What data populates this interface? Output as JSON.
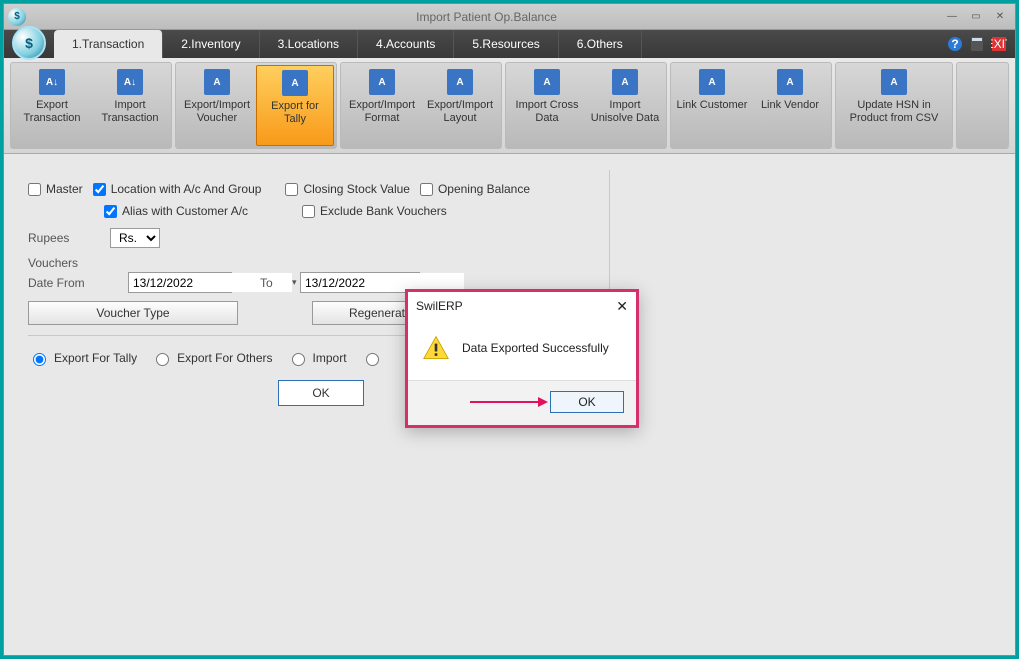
{
  "window": {
    "title": "Import Patient Op.Balance",
    "logo_letter": "$"
  },
  "tabs": {
    "t1": "1.Transaction",
    "t2": "2.Inventory",
    "t3": "3.Locations",
    "t4": "4.Accounts",
    "t5": "5.Resources",
    "t6": "6.Others"
  },
  "ribbon": {
    "g1": {
      "a": "Export Transaction",
      "b": "Import Transaction"
    },
    "g2": {
      "a": "Export/Import Voucher",
      "b": "Export for Tally"
    },
    "g3": {
      "a": "Export/Import Format",
      "b": "Export/Import Layout"
    },
    "g4": {
      "a": "Import Cross Data",
      "b": "Import Unisolve Data"
    },
    "g5": {
      "a": "Link Customer",
      "b": "Link Vendor"
    },
    "g6": {
      "a": "Update HSN in Product from CSV"
    }
  },
  "form": {
    "master": "Master",
    "loc_group": "Location with A/c And Group",
    "closing": "Closing Stock Value",
    "opening": "Opening Balance",
    "alias": "Alias with Customer A/c",
    "exclude_bank": "Exclude Bank Vouchers",
    "rupees_label": "Rupees",
    "rupees_value": "Rs.",
    "vouchers_label": "Vouchers",
    "date_from_label": "Date From",
    "date_from": "13/12/2022",
    "to_label": "To",
    "date_to": "13/12/2022",
    "voucher_type_btn": "Voucher Type",
    "regen_btn": "Regenerate Closing",
    "r_tally": "Export For Tally",
    "r_others": "Export For Others",
    "r_import": "Import",
    "ok": "OK"
  },
  "dialog": {
    "title": "SwilERP",
    "message": "Data Exported Successfully",
    "ok": "OK"
  }
}
